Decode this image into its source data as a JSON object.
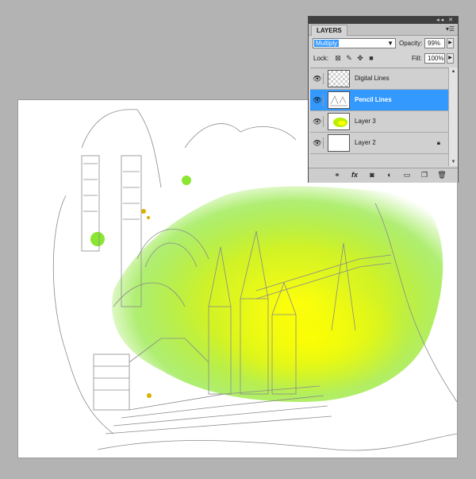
{
  "canvas": {
    "artwork": "pencil-sketch-castle-with-watercolor-wash",
    "wash_colors": [
      "#6ee000",
      "#c8f000",
      "#ffff00"
    ]
  },
  "layers_panel": {
    "tab_label": "LAYERS",
    "panel_menu_icon": "panel-menu-icon",
    "blend_mode": {
      "value": "Multiply"
    },
    "opacity": {
      "label": "Opacity:",
      "value": "99%"
    },
    "lock": {
      "label": "Lock:",
      "icons": [
        "lock-transparent-icon",
        "lock-pixels-icon",
        "lock-position-icon",
        "lock-all-icon"
      ]
    },
    "fill": {
      "label": "Fill:",
      "value": "100%"
    },
    "layers": [
      {
        "name": "Digital Lines",
        "visible": true,
        "thumbnail": "transparent",
        "selected": false,
        "locked": false
      },
      {
        "name": "Pencil Lines",
        "visible": true,
        "thumbnail": "sketch",
        "selected": true,
        "locked": false
      },
      {
        "name": "Layer 3",
        "visible": true,
        "thumbnail": "green-wash",
        "selected": false,
        "locked": false
      },
      {
        "name": "Layer 2",
        "visible": true,
        "thumbnail": "white",
        "selected": false,
        "locked": true
      }
    ],
    "footer_icons": [
      "link-layers-icon",
      "fx-icon",
      "add-mask-icon",
      "adjustment-layer-icon",
      "new-group-icon",
      "new-layer-icon",
      "trash-icon"
    ],
    "selection_color": "#3399ff"
  }
}
